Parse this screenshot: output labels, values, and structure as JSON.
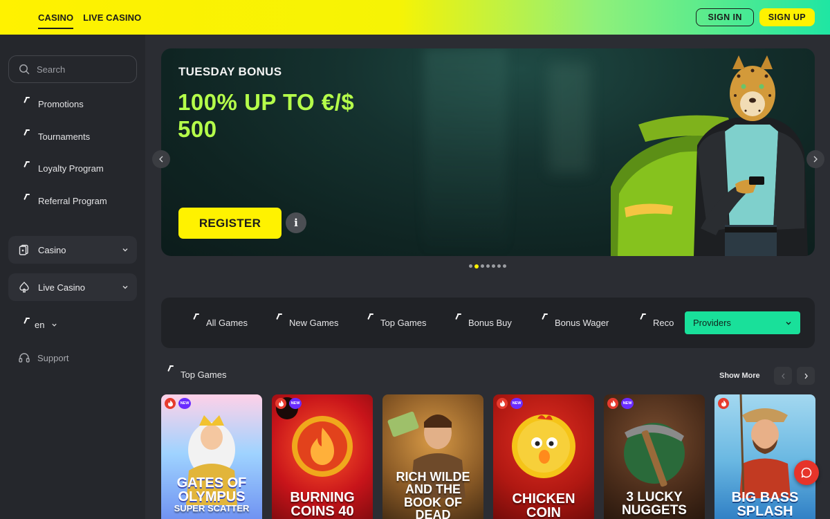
{
  "header": {
    "nav": [
      {
        "label": "CASINO",
        "active": true
      },
      {
        "label": "LIVE CASINO",
        "active": false
      }
    ],
    "sign_in": "SIGN IN",
    "sign_up": "SIGN UP"
  },
  "sidebar": {
    "search_placeholder": "Search",
    "links": [
      "Promotions",
      "Tournaments",
      "Loyalty Program",
      "Referral Program"
    ],
    "sections": [
      {
        "label": "Casino",
        "icon": "cards-icon"
      },
      {
        "label": "Live Casino",
        "icon": "spade-icon"
      }
    ],
    "language": "en",
    "support": "Support"
  },
  "banner": {
    "kicker": "TUESDAY BONUS",
    "title": "100% UP TO €/$ 500",
    "cta": "REGISTER",
    "info": "i",
    "slides": 7,
    "active_slide": 2
  },
  "filters": {
    "tabs": [
      "All Games",
      "New Games",
      "Top Games",
      "Bonus Buy",
      "Bonus Wager",
      "Reco"
    ],
    "providers": "Providers"
  },
  "games": {
    "section_title": "Top Games",
    "show_more": "Show More",
    "cards": [
      {
        "name": "GATES OF OLYMPUS",
        "sub": "SUPER SCATTER",
        "hot": true,
        "new": true
      },
      {
        "name": "BURNING COINS 40",
        "sub": "",
        "hot": true,
        "new": true
      },
      {
        "name": "RICH WILDE AND THE BOOK OF DEAD",
        "sub": "",
        "hot": false,
        "new": false
      },
      {
        "name": "CHICKEN COIN",
        "sub": "",
        "hot": true,
        "new": true
      },
      {
        "name": "3 LUCKY NUGGETS",
        "sub": "",
        "hot": true,
        "new": true
      },
      {
        "name": "BIG BASS SPLASH",
        "sub": "",
        "hot": true,
        "new": false
      }
    ],
    "new_badge": "NEW"
  },
  "colors": {
    "accent_yellow": "#fff200",
    "accent_green": "#19e09a",
    "banner_green": "#b5ff4a",
    "chat_red": "#e6342a"
  }
}
